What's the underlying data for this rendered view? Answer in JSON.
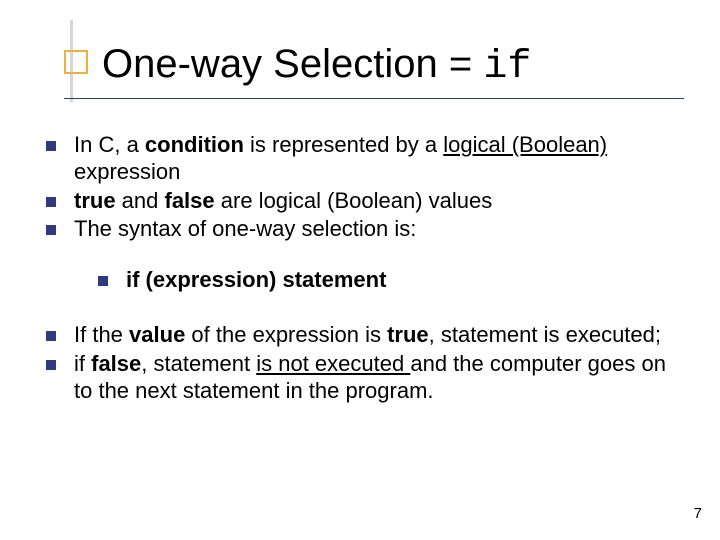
{
  "title": {
    "prefix": "One-way Selection = ",
    "code": "if"
  },
  "bullets": {
    "b1a": "In C, a ",
    "b1b": "condition",
    "b1c": " is represented by a ",
    "b1d": "logical (Boolean)",
    "b1e": " expression",
    "b2a": "true",
    "b2b": " and ",
    "b2c": "false",
    "b2d": " are logical (Boolean) values",
    "b3": "The syntax of one-way selection is:",
    "sub1": "if (expression) statement",
    "b4a": "If the ",
    "b4b": "value",
    "b4c": " of the expression is ",
    "b4d": "true",
    "b4e": ", statement is executed;",
    "b5a": "if ",
    "b5b": "false",
    "b5c": ", statement ",
    "b5d": "is not executed ",
    "b5e": "and the computer goes on to the next statement in the program."
  },
  "pageNumber": "7"
}
